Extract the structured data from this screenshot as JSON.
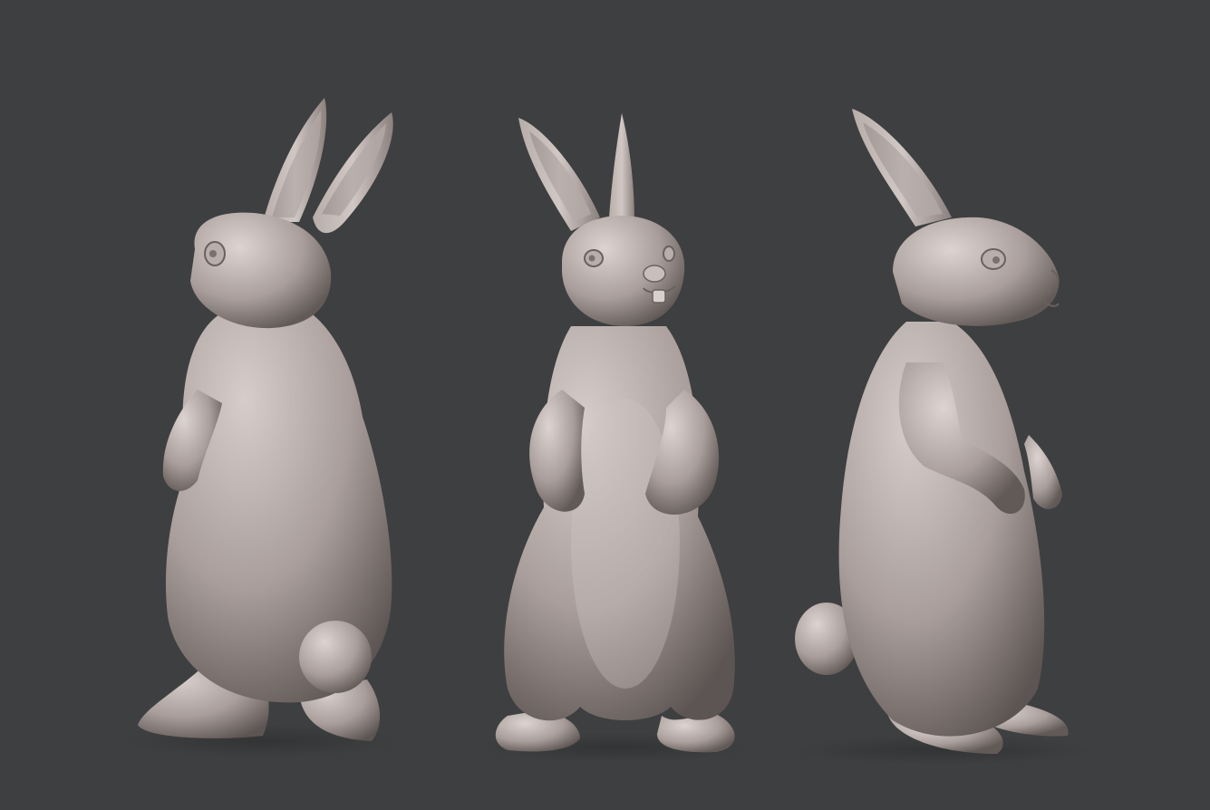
{
  "scene": {
    "background_color": "#3e3f40",
    "clay_base_color": "#a99e9b",
    "clay_light_color": "#d6cdca",
    "clay_shadow_color": "#5d5553",
    "views": [
      {
        "view": "back-three-quarter"
      },
      {
        "view": "front"
      },
      {
        "view": "side-right"
      }
    ]
  }
}
